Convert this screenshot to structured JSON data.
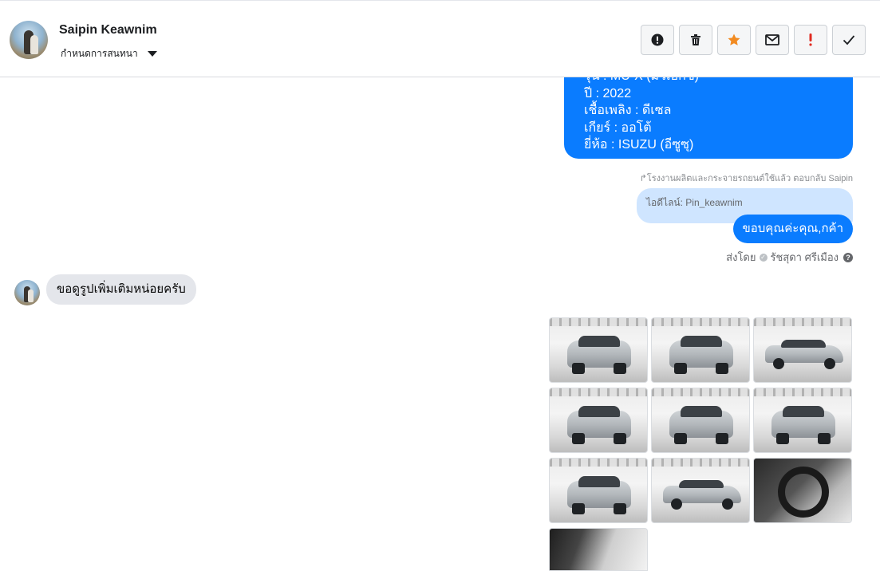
{
  "header": {
    "contact_name": "Saipin Keawnim",
    "status_label": "กำหนดการสนทนา",
    "actions": [
      {
        "name": "report-spam-button",
        "icon": "exclamation-circle-icon"
      },
      {
        "name": "delete-button",
        "icon": "trash-icon"
      },
      {
        "name": "star-button",
        "icon": "star-icon",
        "color": "#f28b21"
      },
      {
        "name": "mark-unread-button",
        "icon": "envelope-icon"
      },
      {
        "name": "mark-important-button",
        "icon": "exclamation-icon",
        "color": "#e02b20"
      },
      {
        "name": "mark-done-button",
        "icon": "check-icon"
      }
    ]
  },
  "messages": {
    "car_details": {
      "model_partial": "รุ่น : MU-X (มิวเอ็กซ์)",
      "year": "ปี : 2022",
      "fuel": "เชื้อเพลิง : ดีเซล",
      "gear": "เกียร์ : ออโต้",
      "brand": "ยี่ห้อ : ISUZU (อีซูซุ)"
    },
    "reply_meta": "↱โรงงานผลิตและกระจายรถยนต์ใช้แล้ว ตอบกลับ Saipin",
    "quote_text": "ไอดีไลน์: Pin_keawnim",
    "thanks_text": "ขอบคุณค่ะคุณ,กค้า",
    "sent_by_label": "ส่งโดย",
    "sent_by_name": "รัชสุดา ศรีเมือง",
    "incoming_text": "ขอดูรูปเพิ่มเติมหน่อยครับ"
  },
  "photos": [
    {
      "kind": "front",
      "alt": "car-photo-1"
    },
    {
      "kind": "rear",
      "alt": "car-photo-2"
    },
    {
      "kind": "side",
      "alt": "car-photo-3"
    },
    {
      "kind": "front",
      "alt": "car-photo-4"
    },
    {
      "kind": "front",
      "alt": "car-photo-5"
    },
    {
      "kind": "rear",
      "alt": "car-photo-6"
    },
    {
      "kind": "rear",
      "alt": "car-photo-7"
    },
    {
      "kind": "side",
      "alt": "car-photo-8"
    },
    {
      "kind": "interior",
      "alt": "car-photo-9"
    },
    {
      "kind": "door",
      "alt": "car-photo-10"
    }
  ]
}
